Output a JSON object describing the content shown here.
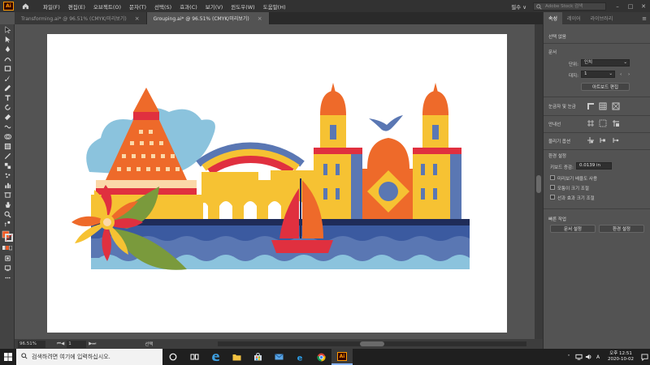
{
  "app": {
    "logo_text": "Ai",
    "menu": [
      "파일(F)",
      "편집(E)",
      "오브젝트(O)",
      "문자(T)",
      "선택(S)",
      "효과(C)",
      "보기(V)",
      "윈도우(W)",
      "도움말(H)"
    ],
    "workspace_label": "필수 ∨",
    "stock_search_placeholder": "Adobe Stock 검색"
  },
  "tabs": [
    {
      "label": "Transforming.ai* @ 96.51% (CMYK/미리보기)",
      "active": false
    },
    {
      "label": "Grouping.ai* @ 96.51% (CMYK/미리보기)",
      "active": true
    }
  ],
  "status": {
    "zoom": "96.51%",
    "artboard_number": "1",
    "selection_label": "선택"
  },
  "panel": {
    "tabs": [
      "속성",
      "레이어",
      "라이브러리"
    ],
    "no_selection": "선택 없음",
    "document_section": "문서",
    "units_label": "단위:",
    "units_value": "인치",
    "artboard_label": "대지:",
    "artboard_value": "1",
    "edit_artboards_button": "아트보드 편집",
    "rulers_grids_section": "눈금자 및 눈금",
    "guides_section": "안내선",
    "snap_section": "물리기 옵션",
    "preferences_section": "환경 설정",
    "keyboard_increment_label": "키보드 증감:",
    "keyboard_increment_value": "0.0139 in",
    "pref_options": [
      "미리보기 배율도 사용",
      "모퉁이 크기 조절",
      "선과 효과 크기 조절"
    ],
    "quick_actions_section": "빠른 작업",
    "document_setup_button": "문서 설정",
    "preferences_button": "환경 설정"
  },
  "taskbar": {
    "search_placeholder": "검색하려면 여기에 입력하십시오.",
    "app_label": "Ai",
    "time_period": "오후 12:51",
    "date": "2020-10-02",
    "ime": "A"
  },
  "colors": {
    "artwork_orange": "#ee6a2a",
    "artwork_red": "#e0303f",
    "artwork_yellow": "#f6c233",
    "artwork_blue": "#5a77b3",
    "artwork_navy": "#1f2c59",
    "artwork_sky": "#8bc3dd",
    "artwork_green": "#7a9a3c"
  }
}
